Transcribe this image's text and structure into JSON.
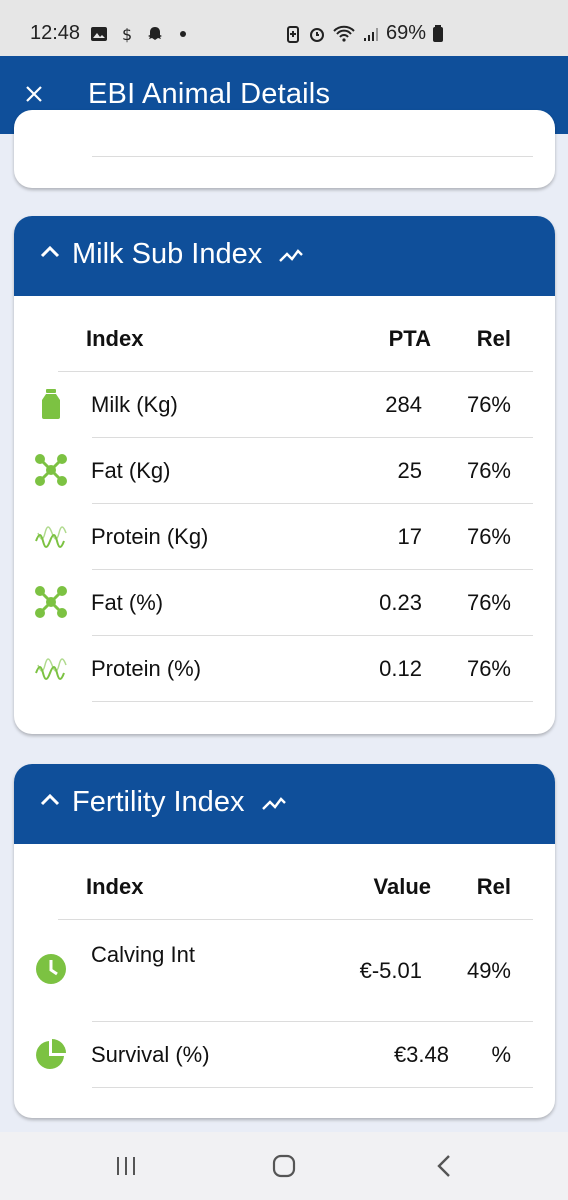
{
  "status": {
    "time": "12:48",
    "battery": "69%"
  },
  "appbar": {
    "title": "EBI Animal Details"
  },
  "milk": {
    "title": "Milk Sub Index",
    "headers": [
      "Index",
      "PTA",
      "Rel"
    ],
    "rows": [
      {
        "label": "Milk (Kg)",
        "value": "284",
        "rel": "76%",
        "icon": "milk-bottle-icon"
      },
      {
        "label": "Fat (Kg)",
        "value": "25",
        "rel": "76%",
        "icon": "molecule-icon"
      },
      {
        "label": "Protein (Kg)",
        "value": "17",
        "rel": "76%",
        "icon": "protein-helix-icon"
      },
      {
        "label": "Fat (%)",
        "value": "0.23",
        "rel": "76%",
        "icon": "molecule-icon"
      },
      {
        "label": "Protein (%)",
        "value": "0.12",
        "rel": "76%",
        "icon": "protein-helix-icon"
      }
    ]
  },
  "fertility": {
    "title": "Fertility Index",
    "headers": [
      "Index",
      "Value",
      "Rel"
    ],
    "rows": [
      {
        "label": "Calving Int",
        "value": "€-5.01",
        "rel": "49%",
        "icon": "clock-icon"
      },
      {
        "label": "Survival (%)",
        "value": "€3.48",
        "rel": "%",
        "icon": "pie-chart-icon"
      }
    ]
  },
  "colors": {
    "primary": "#0f4f9a",
    "accent_green": "#7cc242"
  }
}
